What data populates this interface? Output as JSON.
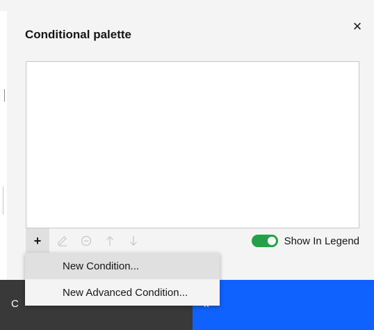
{
  "dialog": {
    "title": "Conditional palette",
    "close_symbol": "×"
  },
  "toolbar": {
    "add_symbol": "+",
    "add_icon": "plus-icon",
    "edit_icon": "pencil-icon",
    "remove_icon": "minus-circle-icon",
    "move_up_icon": "arrow-up-icon",
    "move_down_icon": "arrow-down-icon",
    "show_in_legend": {
      "label": "Show In Legend",
      "on": true,
      "color": "#24a148"
    }
  },
  "add_menu": {
    "items": [
      {
        "label": "New Condition..."
      },
      {
        "label": "New Advanced Condition..."
      }
    ]
  },
  "footer": {
    "secondary_label": "C",
    "primary_label": "k",
    "secondary_color": "#393939",
    "primary_color": "#0f62fe"
  }
}
